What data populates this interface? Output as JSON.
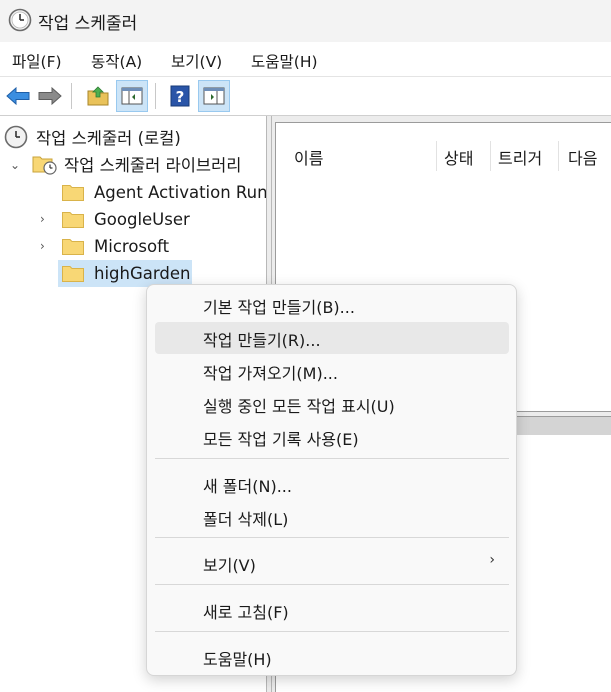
{
  "window": {
    "title": "작업 스케줄러"
  },
  "menubar": {
    "items": [
      "파일(F)",
      "동작(A)",
      "보기(V)",
      "도움말(H)"
    ]
  },
  "toolbar": {
    "buttons": [
      "back-icon",
      "forward-icon",
      "folder-up-icon",
      "show-hide-console-tree-icon",
      "help-icon",
      "show-hide-action-pane-icon"
    ]
  },
  "tree": {
    "root": "작업 스케줄러 (로컬)",
    "library": "작업 스케줄러 라이브러리",
    "children": [
      {
        "label": "Agent Activation Runt",
        "expandable": false
      },
      {
        "label": "GoogleUser",
        "expandable": true
      },
      {
        "label": "Microsoft",
        "expandable": true
      },
      {
        "label": "highGarden",
        "expandable": false,
        "selected": true
      }
    ]
  },
  "list": {
    "columns": [
      "이름",
      "상태",
      "트리거",
      "다음"
    ]
  },
  "context_menu": {
    "items": [
      {
        "label": "기본 작업 만들기(B)..."
      },
      {
        "label": "작업 만들기(R)...",
        "highlighted": true
      },
      {
        "label": "작업 가져오기(M)..."
      },
      {
        "label": "실행 중인 모든 작업 표시(U)"
      },
      {
        "label": "모든 작업 기록 사용(E)"
      },
      {
        "label": "새 폴더(N)..."
      },
      {
        "label": "폴더 삭제(L)"
      },
      {
        "label": "보기(V)",
        "submenu": true,
        "submenu_glyph": "›"
      },
      {
        "label": "새로 고침(F)"
      },
      {
        "label": "도움말(H)"
      }
    ]
  },
  "colors": {
    "selection": "#cce4f7",
    "folder": "#f8d775",
    "menu_hover": "#e8e8e8"
  }
}
